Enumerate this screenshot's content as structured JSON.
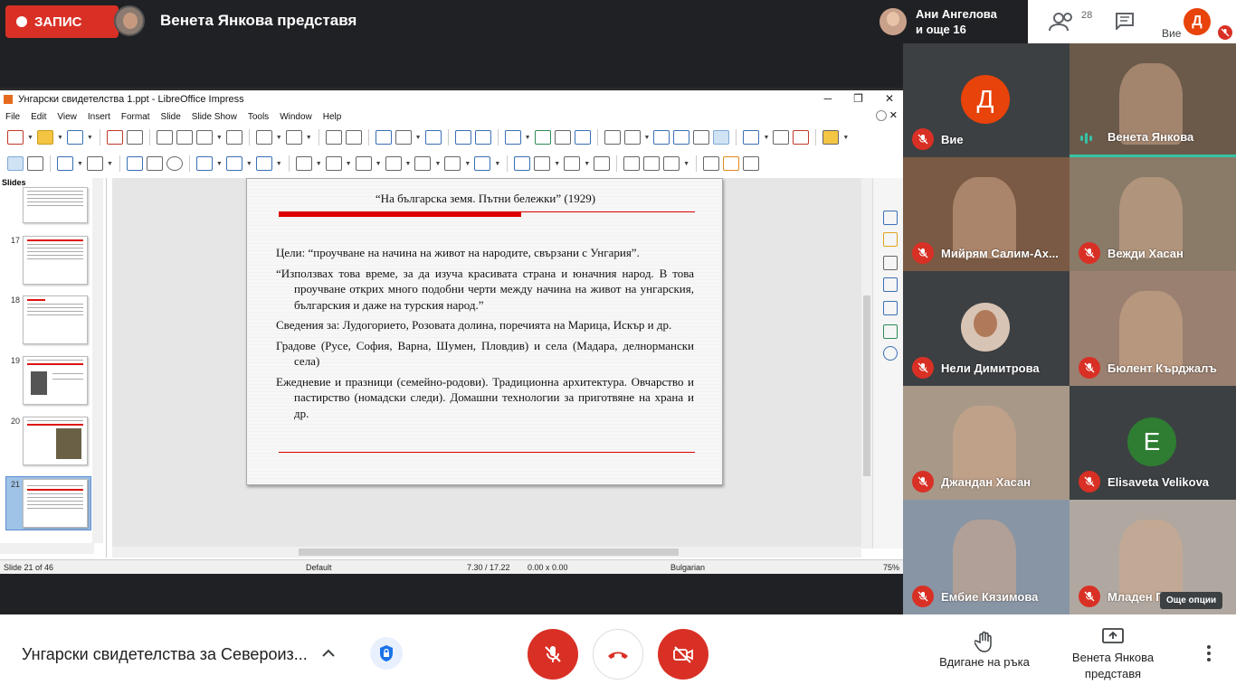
{
  "topbar": {
    "record_label": "ЗАПИС",
    "presenting_text": "Венета Янкова представя",
    "others_line1": "Ани Ангелова",
    "others_line2": "и още 16",
    "people_count": "28",
    "self_initial": "Д",
    "self_label": "Вие"
  },
  "lo": {
    "window_title": "Унгарски свидетелства 1.ppt - LibreOffice Impress",
    "menu": [
      "File",
      "Edit",
      "View",
      "Insert",
      "Format",
      "Slide",
      "Slide Show",
      "Tools",
      "Window",
      "Help"
    ],
    "slides_pane_title": "Slides",
    "thumb_numbers": [
      "17",
      "18",
      "19",
      "20",
      "21"
    ],
    "slide": {
      "title": "“На българска земя. Пътни бележки” (1929)",
      "paragraphs": [
        "Цели: “проучване на начина на живот на народите, свързани с Унгария”.",
        "“Използвах това време, за да изуча красивата страна и юначния народ. В това проучване открих много подобни черти между начина на живот на унгарския, българския и даже на турския народ.”",
        "Сведения за: Лудогорието, Розовата долина, поречията на Марица, Искър и др.",
        "Градове (Русе, София, Варна, Шумен, Пловдив) и села (Мадара, делнормански села)",
        "Ежедневие и празници (семейно-родови). Традиционна архитектура. Овчарство и пастирство (номадски следи). Домашни технологии за приготвяне на храна и др."
      ]
    },
    "status": {
      "slide_of": "Slide 21 of 46",
      "layout": "Default",
      "position": "7.30 / 17.22",
      "size": "0.00 x 0.00",
      "language": "Bulgarian",
      "zoom": "75%"
    }
  },
  "participants": [
    {
      "name": "Вие",
      "type": "letter",
      "letter": "Д",
      "color": "#e8430a",
      "bg": "#3c4043"
    },
    {
      "name": "Венета Янкова",
      "type": "video",
      "bg": "#6b5a4a",
      "speaking": true
    },
    {
      "name": "Мийрям Салим-Ах...",
      "type": "video",
      "bg": "#7a5a44"
    },
    {
      "name": "Вежди Хасан",
      "type": "video",
      "bg": "#8a7a68"
    },
    {
      "name": "Нели Димитрова",
      "type": "photo",
      "bg": "#3c4043"
    },
    {
      "name": "Бюлент Кърджалъ",
      "type": "video",
      "bg": "#9a8070"
    },
    {
      "name": "Джандан Хасан",
      "type": "video",
      "bg": "#a89888"
    },
    {
      "name": "Elisaveta Velikova",
      "type": "letter",
      "letter": "E",
      "color": "#2e7d32",
      "bg": "#3c4043"
    },
    {
      "name": "Ембие Кязимова",
      "type": "video",
      "bg": "#8895a5"
    },
    {
      "name": "Младен П",
      "type": "video",
      "bg": "#b0a8a0"
    }
  ],
  "tooltip": "Още опции",
  "bottom": {
    "meeting_title": "Унгарски свидетелства за Североиз...",
    "raise_hand": "Вдигане на ръка",
    "present_line1": "Венета Янкова",
    "present_line2": "представя"
  }
}
